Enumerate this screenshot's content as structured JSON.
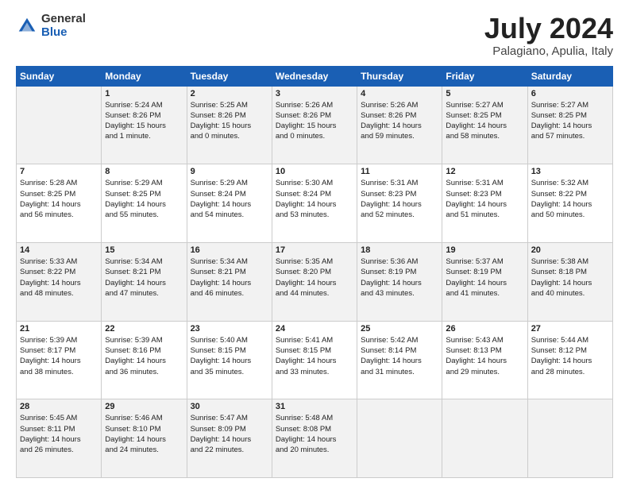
{
  "header": {
    "logo_general": "General",
    "logo_blue": "Blue",
    "month_title": "July 2024",
    "location": "Palagiano, Apulia, Italy"
  },
  "weekdays": [
    "Sunday",
    "Monday",
    "Tuesday",
    "Wednesday",
    "Thursday",
    "Friday",
    "Saturday"
  ],
  "weeks": [
    [
      {
        "date": "",
        "info": ""
      },
      {
        "date": "1",
        "info": "Sunrise: 5:24 AM\nSunset: 8:26 PM\nDaylight: 15 hours\nand 1 minute."
      },
      {
        "date": "2",
        "info": "Sunrise: 5:25 AM\nSunset: 8:26 PM\nDaylight: 15 hours\nand 0 minutes."
      },
      {
        "date": "3",
        "info": "Sunrise: 5:26 AM\nSunset: 8:26 PM\nDaylight: 15 hours\nand 0 minutes."
      },
      {
        "date": "4",
        "info": "Sunrise: 5:26 AM\nSunset: 8:26 PM\nDaylight: 14 hours\nand 59 minutes."
      },
      {
        "date": "5",
        "info": "Sunrise: 5:27 AM\nSunset: 8:25 PM\nDaylight: 14 hours\nand 58 minutes."
      },
      {
        "date": "6",
        "info": "Sunrise: 5:27 AM\nSunset: 8:25 PM\nDaylight: 14 hours\nand 57 minutes."
      }
    ],
    [
      {
        "date": "7",
        "info": "Sunrise: 5:28 AM\nSunset: 8:25 PM\nDaylight: 14 hours\nand 56 minutes."
      },
      {
        "date": "8",
        "info": "Sunrise: 5:29 AM\nSunset: 8:25 PM\nDaylight: 14 hours\nand 55 minutes."
      },
      {
        "date": "9",
        "info": "Sunrise: 5:29 AM\nSunset: 8:24 PM\nDaylight: 14 hours\nand 54 minutes."
      },
      {
        "date": "10",
        "info": "Sunrise: 5:30 AM\nSunset: 8:24 PM\nDaylight: 14 hours\nand 53 minutes."
      },
      {
        "date": "11",
        "info": "Sunrise: 5:31 AM\nSunset: 8:23 PM\nDaylight: 14 hours\nand 52 minutes."
      },
      {
        "date": "12",
        "info": "Sunrise: 5:31 AM\nSunset: 8:23 PM\nDaylight: 14 hours\nand 51 minutes."
      },
      {
        "date": "13",
        "info": "Sunrise: 5:32 AM\nSunset: 8:22 PM\nDaylight: 14 hours\nand 50 minutes."
      }
    ],
    [
      {
        "date": "14",
        "info": "Sunrise: 5:33 AM\nSunset: 8:22 PM\nDaylight: 14 hours\nand 48 minutes."
      },
      {
        "date": "15",
        "info": "Sunrise: 5:34 AM\nSunset: 8:21 PM\nDaylight: 14 hours\nand 47 minutes."
      },
      {
        "date": "16",
        "info": "Sunrise: 5:34 AM\nSunset: 8:21 PM\nDaylight: 14 hours\nand 46 minutes."
      },
      {
        "date": "17",
        "info": "Sunrise: 5:35 AM\nSunset: 8:20 PM\nDaylight: 14 hours\nand 44 minutes."
      },
      {
        "date": "18",
        "info": "Sunrise: 5:36 AM\nSunset: 8:19 PM\nDaylight: 14 hours\nand 43 minutes."
      },
      {
        "date": "19",
        "info": "Sunrise: 5:37 AM\nSunset: 8:19 PM\nDaylight: 14 hours\nand 41 minutes."
      },
      {
        "date": "20",
        "info": "Sunrise: 5:38 AM\nSunset: 8:18 PM\nDaylight: 14 hours\nand 40 minutes."
      }
    ],
    [
      {
        "date": "21",
        "info": "Sunrise: 5:39 AM\nSunset: 8:17 PM\nDaylight: 14 hours\nand 38 minutes."
      },
      {
        "date": "22",
        "info": "Sunrise: 5:39 AM\nSunset: 8:16 PM\nDaylight: 14 hours\nand 36 minutes."
      },
      {
        "date": "23",
        "info": "Sunrise: 5:40 AM\nSunset: 8:15 PM\nDaylight: 14 hours\nand 35 minutes."
      },
      {
        "date": "24",
        "info": "Sunrise: 5:41 AM\nSunset: 8:15 PM\nDaylight: 14 hours\nand 33 minutes."
      },
      {
        "date": "25",
        "info": "Sunrise: 5:42 AM\nSunset: 8:14 PM\nDaylight: 14 hours\nand 31 minutes."
      },
      {
        "date": "26",
        "info": "Sunrise: 5:43 AM\nSunset: 8:13 PM\nDaylight: 14 hours\nand 29 minutes."
      },
      {
        "date": "27",
        "info": "Sunrise: 5:44 AM\nSunset: 8:12 PM\nDaylight: 14 hours\nand 28 minutes."
      }
    ],
    [
      {
        "date": "28",
        "info": "Sunrise: 5:45 AM\nSunset: 8:11 PM\nDaylight: 14 hours\nand 26 minutes."
      },
      {
        "date": "29",
        "info": "Sunrise: 5:46 AM\nSunset: 8:10 PM\nDaylight: 14 hours\nand 24 minutes."
      },
      {
        "date": "30",
        "info": "Sunrise: 5:47 AM\nSunset: 8:09 PM\nDaylight: 14 hours\nand 22 minutes."
      },
      {
        "date": "31",
        "info": "Sunrise: 5:48 AM\nSunset: 8:08 PM\nDaylight: 14 hours\nand 20 minutes."
      },
      {
        "date": "",
        "info": ""
      },
      {
        "date": "",
        "info": ""
      },
      {
        "date": "",
        "info": ""
      }
    ]
  ]
}
